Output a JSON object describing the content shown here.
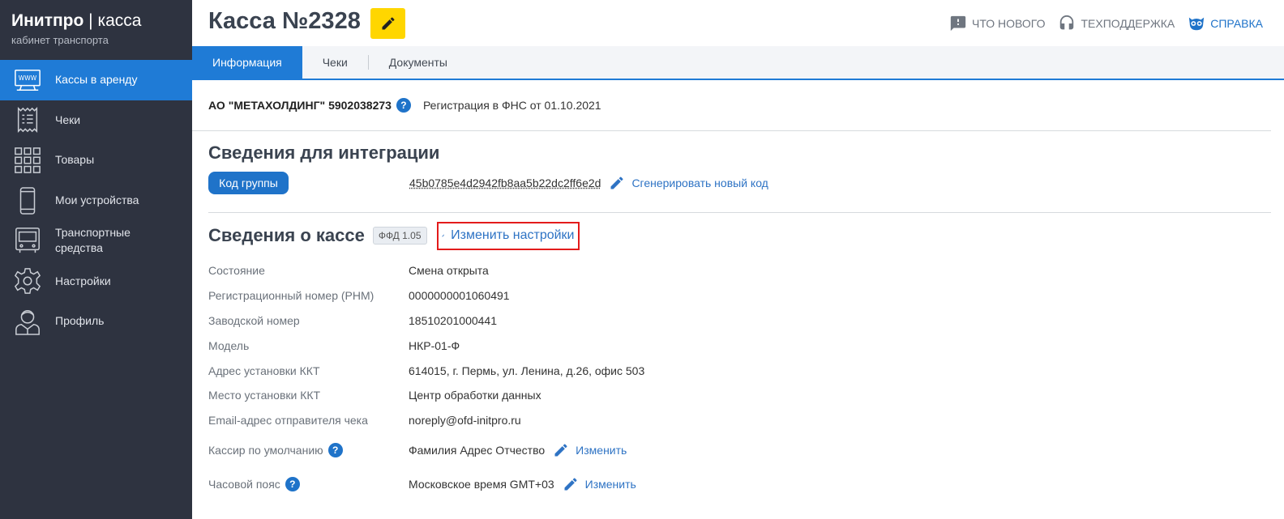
{
  "brand": {
    "title_bold": "Инитпро",
    "title_sep": " | ",
    "title_thin": "касса",
    "subtitle": "кабинет транспорта"
  },
  "sidebar": {
    "items": [
      {
        "label": "Кассы в аренду",
        "icon": "cash-register-icon",
        "active": true
      },
      {
        "label": "Чеки",
        "icon": "receipt-icon"
      },
      {
        "label": "Товары",
        "icon": "grid-icon"
      },
      {
        "label": "Мои устройства",
        "icon": "phone-icon"
      },
      {
        "label": "Транспортные средства",
        "icon": "bus-icon"
      },
      {
        "label": "Настройки",
        "icon": "gear-icon"
      },
      {
        "label": "Профиль",
        "icon": "user-icon"
      }
    ]
  },
  "header": {
    "title": "Касса №2328",
    "links": {
      "whats_new": "ЧТО НОВОГО",
      "support": "ТЕХПОДДЕРЖКА",
      "help": "СПРАВКА"
    }
  },
  "tabs": [
    "Информация",
    "Чеки",
    "Документы"
  ],
  "org": {
    "name": "АО \"МЕТАХОЛДИНГ\" 5902038273",
    "help_glyph": "?",
    "registration": "Регистрация в ФНС от 01.10.2021"
  },
  "integration": {
    "title": "Сведения для интеграции",
    "group_label": "Код группы",
    "group_code": "45b0785e4d2942fb8aa5b22dc2ff6e2d",
    "generate_link": "Сгенерировать новый код"
  },
  "kassa": {
    "title": "Сведения о кассе",
    "ffd": "ФФД 1.05",
    "settings_link": "Изменить настройки",
    "rows": [
      {
        "label": "Состояние",
        "value": "Смена открыта"
      },
      {
        "label": "Регистрационный номер (РНМ)",
        "value": "0000000001060491"
      },
      {
        "label": "Заводской номер",
        "value": "18510201000441"
      },
      {
        "label": "Модель",
        "value": "НКР-01-Ф"
      },
      {
        "label": "Адрес установки ККТ",
        "value": "614015, г. Пермь, ул. Ленина, д.26, офис 503"
      },
      {
        "label": "Место установки ККТ",
        "value": "Центр обработки данных"
      },
      {
        "label": "Email-адрес отправителя чека",
        "value": "noreply@ofd-initpro.ru"
      }
    ],
    "cashier": {
      "label": "Кассир по умолчанию",
      "value": "Фамилия Адрес Отчество",
      "edit": "Изменить"
    },
    "timezone": {
      "label": "Часовой пояс",
      "value": "Московское время GMT+03",
      "edit": "Изменить"
    }
  },
  "colors": {
    "sidebar_bg": "#2e3340",
    "accent": "#1f7bd6",
    "yellow": "#ffd600",
    "highlight_red": "#e31b1b"
  }
}
